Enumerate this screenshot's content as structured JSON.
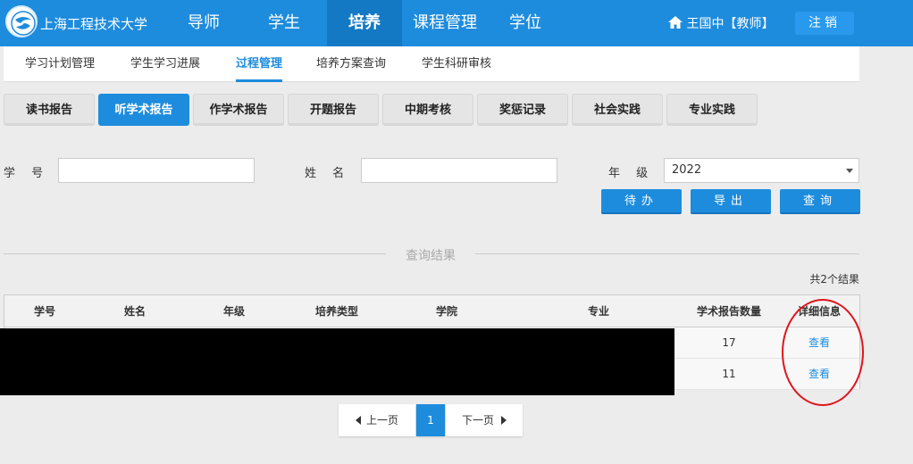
{
  "header": {
    "school_name": "上海工程技术大学",
    "nav": [
      {
        "label": "导师"
      },
      {
        "label": "学生"
      },
      {
        "label": "培养",
        "active": true
      },
      {
        "label": "课程管理"
      },
      {
        "label": "学位"
      }
    ],
    "user": "王国中【教师】",
    "logout": "注销"
  },
  "subnav": [
    {
      "label": "学习计划管理"
    },
    {
      "label": "学生学习进展"
    },
    {
      "label": "过程管理",
      "active": true
    },
    {
      "label": "培养方案查询"
    },
    {
      "label": "学生科研审核"
    }
  ],
  "tabs": [
    {
      "label": "读书报告"
    },
    {
      "label": "听学术报告",
      "active": true
    },
    {
      "label": "作学术报告"
    },
    {
      "label": "开题报告"
    },
    {
      "label": "中期考核"
    },
    {
      "label": "奖惩记录"
    },
    {
      "label": "社会实践"
    },
    {
      "label": "专业实践"
    }
  ],
  "filters": {
    "student_id_label": "学 号",
    "student_id_value": "",
    "name_label": "姓 名",
    "name_value": "",
    "grade_label": "年 级",
    "grade_value": "2022"
  },
  "buttons": {
    "todo": "待办",
    "export": "导出",
    "query": "查询"
  },
  "results": {
    "title": "查询结果",
    "count_text": "共2个结果"
  },
  "table": {
    "headers": [
      "学号",
      "姓名",
      "年级",
      "培养类型",
      "学院",
      "专业",
      "学术报告数量",
      "详细信息"
    ],
    "rows": [
      {
        "report_count": "17",
        "detail": "查看"
      },
      {
        "report_count": "11",
        "detail": "查看"
      }
    ]
  },
  "pagination": {
    "prev": "上一页",
    "current": "1",
    "next": "下一页"
  },
  "colors": {
    "primary": "#1e8cdd",
    "annotation": "#e0141e"
  }
}
